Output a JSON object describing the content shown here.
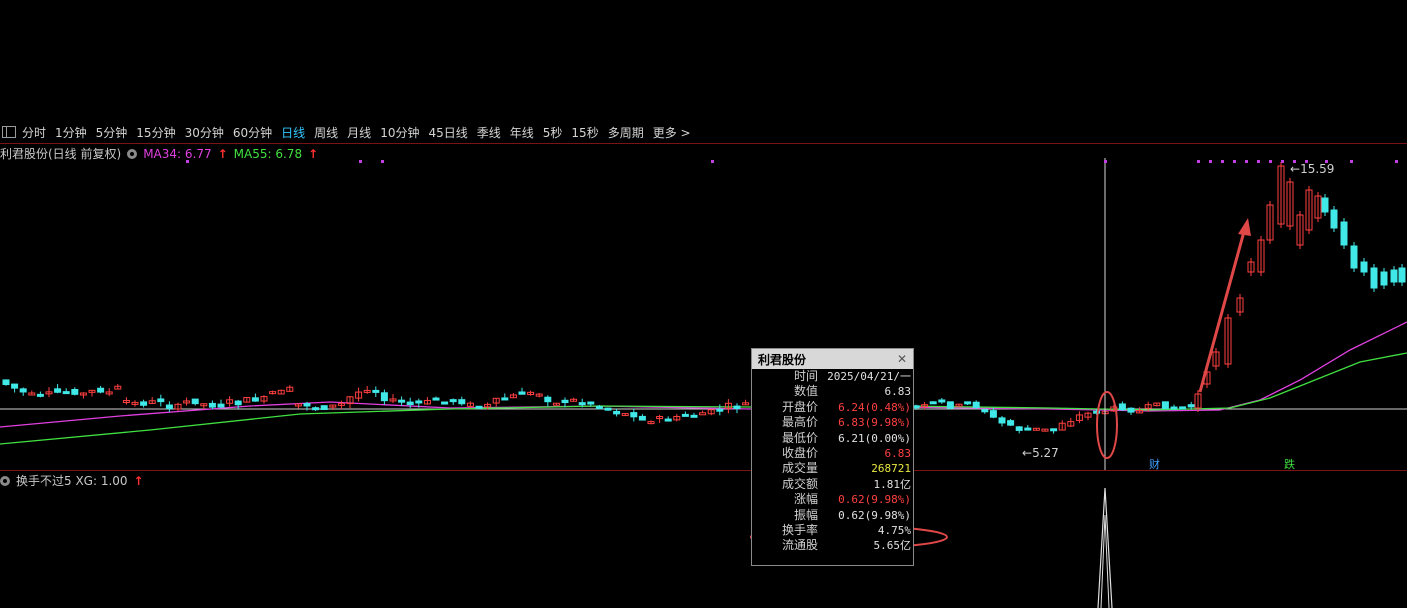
{
  "toolbar": {
    "items": [
      {
        "label": "分时"
      },
      {
        "label": "1分钟"
      },
      {
        "label": "5分钟"
      },
      {
        "label": "15分钟"
      },
      {
        "label": "30分钟"
      },
      {
        "label": "60分钟"
      },
      {
        "label": "日线",
        "active": true
      },
      {
        "label": "周线"
      },
      {
        "label": "月线"
      },
      {
        "label": "10分钟"
      },
      {
        "label": "45日线"
      },
      {
        "label": "季线"
      },
      {
        "label": "年线"
      },
      {
        "label": "5秒"
      },
      {
        "label": "15秒"
      },
      {
        "label": "多周期"
      },
      {
        "label": "更多 >"
      }
    ]
  },
  "main_chart": {
    "title": "利君股份(日线 前复权)",
    "ma34_label": "MA34: 6.77",
    "ma55_label": "MA55: 6.78",
    "high_label": "15.59",
    "low_label": "5.27",
    "tag_cai": "财",
    "tag_die": "跌",
    "colors": {
      "up": "#ff4040",
      "down": "#40e8e8",
      "ma34": "#e040e0",
      "ma55": "#40e040",
      "dots": "#c040e0"
    }
  },
  "sub_chart": {
    "title": "换手不过5 XG: 1.00"
  },
  "info_panel": {
    "title": "利君股份",
    "close": "✕",
    "rows": [
      {
        "label": "时间",
        "value": "2025/04/21/一",
        "color": "white"
      },
      {
        "label": "数值",
        "value": "6.83",
        "color": "white"
      },
      {
        "label": "开盘价",
        "value": "6.24(0.48%)",
        "color": "red"
      },
      {
        "label": "最高价",
        "value": "6.83(9.98%)",
        "color": "red"
      },
      {
        "label": "最低价",
        "value": "6.21(0.00%)",
        "color": "white"
      },
      {
        "label": "收盘价",
        "value": "6.83",
        "color": "red"
      },
      {
        "label": "成交量",
        "value": "268721",
        "color": "yellow"
      },
      {
        "label": "成交额",
        "value": "1.81亿",
        "color": "white"
      },
      {
        "label": "涨幅",
        "value": "0.62(9.98%)",
        "color": "red"
      },
      {
        "label": "振幅",
        "value": "0.62(9.98%)",
        "color": "white"
      },
      {
        "label": "换手率",
        "value": "4.75%",
        "color": "white"
      },
      {
        "label": "流通股",
        "value": "5.65亿",
        "color": "white"
      }
    ]
  }
}
